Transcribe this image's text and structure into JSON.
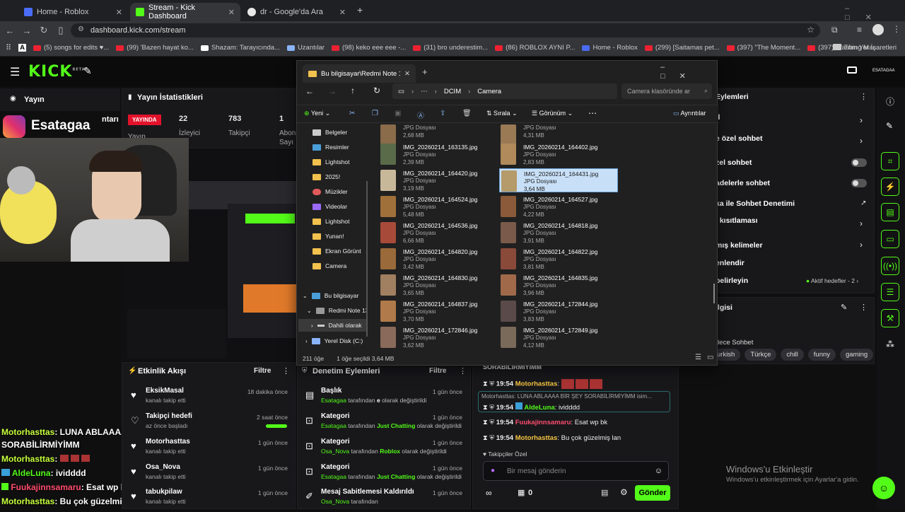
{
  "browser": {
    "tabs": [
      {
        "label": "Home - Roblox",
        "color": "#4a6cf7"
      },
      {
        "label": "Stream - Kick Dashboard",
        "color": "#53fc18"
      },
      {
        "label": "dr - Google'da Ara",
        "color": "#e8e8e8"
      }
    ],
    "url": "dashboard.kick.com/stream",
    "bookmarks": [
      "A",
      "(5) songs for edits ♥...",
      "(99) 'Bazen hayat ko...",
      "Shazam: Tarayıcında...",
      "Uzantılar",
      "(98) keko eee eee -...",
      "(31) bro underestim...",
      "(86) ROBLOX AYNI P...",
      "Home - Roblox",
      "(299) [Saitamas pet...",
      "(397) \"The Moment...",
      "(397) Washing Mac..."
    ],
    "all_bookmarks": "Tüm Yer İşaretleri"
  },
  "kick": {
    "logo": "KICK",
    "logo_sup": "BETA",
    "top_right_label": "ESATAGAA",
    "stream_tab": "Yayın",
    "stats_title": "Yayın İstatistikleri",
    "live_badge": "YAYINDA",
    "live_sub": "Yayın",
    "stats": [
      {
        "value": "22",
        "label": "İzleyici"
      },
      {
        "value": "783",
        "label": "Takipçi"
      },
      {
        "value": "1",
        "label": "Abon"
      }
    ],
    "stats_partial": "Sayı",
    "overlay_name": "Esatagaa",
    "overlay_partial": "ntarı",
    "events_title": "Etkinlik Akışı",
    "filter": "Filtre",
    "events": [
      {
        "name": "EksikMasal",
        "sub": "kanalı takip etti",
        "time": "18 dakika önce",
        "icon": "heart"
      },
      {
        "name": "Takipçi hedefi",
        "sub": "az önce başladı",
        "time": "2 saat önce",
        "icon": "heart-outline"
      },
      {
        "name": "Motorhasttas",
        "sub": "kanalı takip etti",
        "time": "1 gün önce",
        "icon": "heart"
      },
      {
        "name": "Osa_Nova",
        "sub": "kanalı takip etti",
        "time": "1 gün önce",
        "icon": "heart"
      },
      {
        "name": "tabukpilaw",
        "sub": "kanalı takip etti",
        "time": "1 gün önce",
        "icon": "heart"
      }
    ],
    "goal_progress": 1.0,
    "mod_title": "Denetim Eylemleri",
    "mod_actions": [
      {
        "title": "Başlık",
        "actor": "Esatagaa",
        "mid": "tarafından",
        "value": "e",
        "rest": "olarak değiştirildi",
        "time": "1 gün önce"
      },
      {
        "title": "Kategori",
        "actor": "Esatagaa",
        "mid": "tarafından",
        "value": "Just Chatting",
        "rest": "olarak değiştirildi",
        "time": "1 gün önce"
      },
      {
        "title": "Kategori",
        "actor": "Osa_Nova",
        "mid": "tarafından",
        "value": "Roblox",
        "rest": "olarak değiştirildi",
        "time": "1 gün önce"
      },
      {
        "title": "Kategori",
        "actor": "Esatagaa",
        "mid": "tarafından",
        "value": "Just Chatting",
        "rest": "olarak değiştirildi",
        "time": "1 gün önce"
      },
      {
        "title": "Mesaj Sabitlemesi Kaldırıldı",
        "actor": "Osa_Nova",
        "mid": "tarafından",
        "value": "",
        "rest": "",
        "time": "1 gün önce"
      }
    ],
    "chat": {
      "header_partial": "SORABİLİRMİYİMM",
      "reply": "Motorhasttas: LUNA ABLAAAA BİR ŞEY SORABİLİRMİYİMM isim...",
      "lines": [
        {
          "time": "19:54",
          "user": "Motorhasttas",
          "msg": ":",
          "color": "#f5c542"
        },
        {
          "time": "19:54",
          "user": "AldeLuna",
          "msg": "ividddd",
          "color": "#53fc18"
        },
        {
          "time": "19:54",
          "user": "Fuukajinnsamaru",
          "msg": "Esat wp bk",
          "color": "#ff4d6d"
        },
        {
          "time": "19:54",
          "user": "Motorhasttas",
          "msg": "Bu çok güzelmiş lan",
          "color": "#f5c542"
        }
      ],
      "followers_only": "Takipçiler Özel",
      "placeholder": "Bir mesaj gönderin",
      "count": "0",
      "send": "Gönder"
    },
    "overlay_chat": [
      {
        "user": "Motorhasttas",
        "msg": ": LUNA ABLAAAA BİR ŞEY"
      },
      {
        "user": "",
        "msg": "SORABİLİRMİYİMM"
      },
      {
        "user": "Motorhasttas",
        "msg": ":"
      },
      {
        "user": "AldeLuna",
        "msg": ": ividddd"
      },
      {
        "user": "Fuukajinnsamaru",
        "msg": ": Esat wp bk"
      },
      {
        "user": "Motorhasttas",
        "msg": ": Bu çok güzelmiş lan"
      }
    ],
    "right_panel": {
      "title_partial": "Eylemleri",
      "rows": [
        "d",
        "e özel sohbet",
        "zel sohbet",
        "adelerle sohbet",
        "ka ile Sohbet Denetimi",
        "i kısıtlaması",
        "mış kelimeler",
        "enlendir",
        "belirleyin"
      ],
      "active_goals": "Aktif hedefler - 2",
      "info_partial": "ilgisi",
      "lang_partial": "dece Sohbet",
      "tags": [
        "urkish",
        "Türkçe",
        "chill",
        "funny",
        "gaming"
      ]
    },
    "watermark_title": "Windows'u Etkinleştir",
    "watermark_sub": "Windows'u etkinleştirmek için Ayarlar'a gidin."
  },
  "explorer": {
    "tab": "Bu bilgisayar\\Redmi Note 13\\",
    "path": [
      "DCIM",
      "Camera"
    ],
    "search_placeholder": "Camera klasöründe ar",
    "new": "Yeni",
    "sort": "Sırala",
    "view": "Görünüm",
    "details": "Ayrıntılar",
    "nav": [
      "Belgeler",
      "Resimler",
      "Lightshot",
      "2025!",
      "Müzikler",
      "Videolar",
      "Lightshot",
      "Yunan!",
      "Ekran Görünt",
      "Camera"
    ],
    "tree": [
      "Bu bilgisayar",
      "Redmi Note 13",
      "Dahili olarak",
      "Yerel Disk (C:)"
    ],
    "files": [
      {
        "name": "",
        "type": "JPG Dosyası",
        "size": "2,68 MB",
        "color": "#8a6b4a"
      },
      {
        "name": "",
        "type": "JPG Dosyası",
        "size": "4,31 MB",
        "color": "#9a7a55"
      },
      {
        "name": "IMG_20260214_163135.jpg",
        "type": "JPG Dosyası",
        "size": "2,39 MB",
        "color": "#5a6b4a"
      },
      {
        "name": "IMG_20260214_164402.jpg",
        "type": "JPG Dosyası",
        "size": "2,83 MB",
        "color": "#b08a5a"
      },
      {
        "name": "IMG_20260214_164420.jpg",
        "type": "JPG Dosyası",
        "size": "3,19 MB",
        "color": "#c8b89a"
      },
      {
        "name": "IMG_20260214_164431.jpg",
        "type": "JPG Dosyası",
        "size": "3,64 MB",
        "color": "#b59a6a"
      },
      {
        "name": "IMG_20260214_164524.jpg",
        "type": "JPG Dosyası",
        "size": "5,48 MB",
        "color": "#a0703a"
      },
      {
        "name": "IMG_20260214_164527.jpg",
        "type": "JPG Dosyası",
        "size": "4,22 MB",
        "color": "#8a5a3a"
      },
      {
        "name": "IMG_20260214_164536.jpg",
        "type": "JPG Dosyası",
        "size": "6,66 MB",
        "color": "#a84a3a"
      },
      {
        "name": "IMG_20260214_164818.jpg",
        "type": "JPG Dosyası",
        "size": "3,91 MB",
        "color": "#7a5a4a"
      },
      {
        "name": "IMG_20260214_164820.jpg",
        "type": "JPG Dosyası",
        "size": "3,42 MB",
        "color": "#9a6a3a"
      },
      {
        "name": "IMG_20260214_164822.jpg",
        "type": "JPG Dosyası",
        "size": "3,81 MB",
        "color": "#8a4a3a"
      },
      {
        "name": "IMG_20260214_164830.jpg",
        "type": "JPG Dosyası",
        "size": "3,65 MB",
        "color": "#a08060"
      },
      {
        "name": "IMG_20260214_164835.jpg",
        "type": "JPG Dosyası",
        "size": "3,96 MB",
        "color": "#a06a4a"
      },
      {
        "name": "IMG_20260214_164837.jpg",
        "type": "JPG Dosyası",
        "size": "3,70 MB",
        "color": "#b07a4a"
      },
      {
        "name": "IMG_20260214_172844.jpg",
        "type": "JPG Dosyası",
        "size": "3,83 MB",
        "color": "#5a4a4a"
      },
      {
        "name": "IMG_20260214_172846.jpg",
        "type": "JPG Dosyası",
        "size": "3,62 MB",
        "color": "#8a6a5a"
      },
      {
        "name": "IMG_20260214_172849.jpg",
        "type": "JPG Dosyası",
        "size": "4,12 MB",
        "color": "#7a6a5a"
      }
    ],
    "status_count": "211 öğe",
    "status_selected": "1 öğe seçildi",
    "status_size": "3,64 MB"
  }
}
